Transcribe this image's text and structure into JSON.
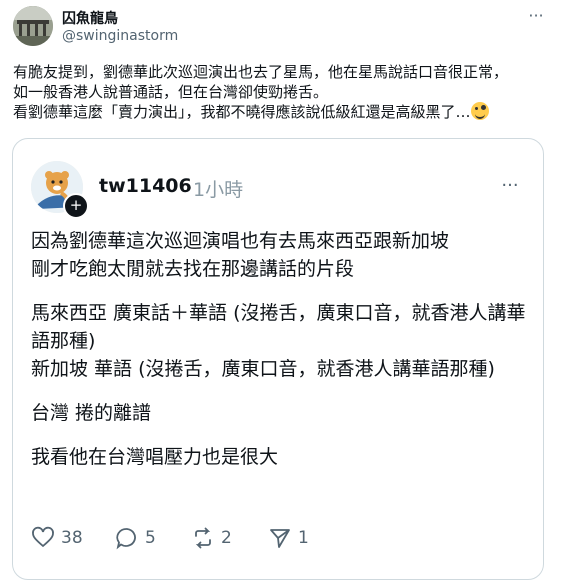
{
  "tweet": {
    "author_name": "囚魚龍鳥",
    "author_handle": "@swinginastorm",
    "more_label": "···",
    "lines": [
      "有脆友提到，劉德華此次巡迴演出也去了星馬，他在星馬說話口音很正常，",
      "如一般香港人說普通話，但在台灣卻使勁捲舌。",
      "看劉德華這麼「賣力演出」，我都不曉得應該說低級紅還是高級黑了…"
    ],
    "emoji_icon": "zany-face-icon"
  },
  "quoted": {
    "username": "tw11406",
    "time": "1小時",
    "more_label": "···",
    "plus_label": "+",
    "paragraphs": [
      "因為劉德華這次巡迴演唱也有去馬來西亞跟新加坡",
      "剛才吃飽太閒就去找在那邊講話的片段",
      "馬來西亞 廣東話＋華語 (沒捲舌，廣東口音，就香港人講華語那種)",
      "新加坡 華語 (沒捲舌，廣東口音，就香港人講華語那種)",
      "台灣 捲的離譜",
      "我看他在台灣唱壓力也是很大"
    ],
    "actions": {
      "likes": "38",
      "replies": "5",
      "reposts": "2",
      "shares": "1"
    }
  }
}
